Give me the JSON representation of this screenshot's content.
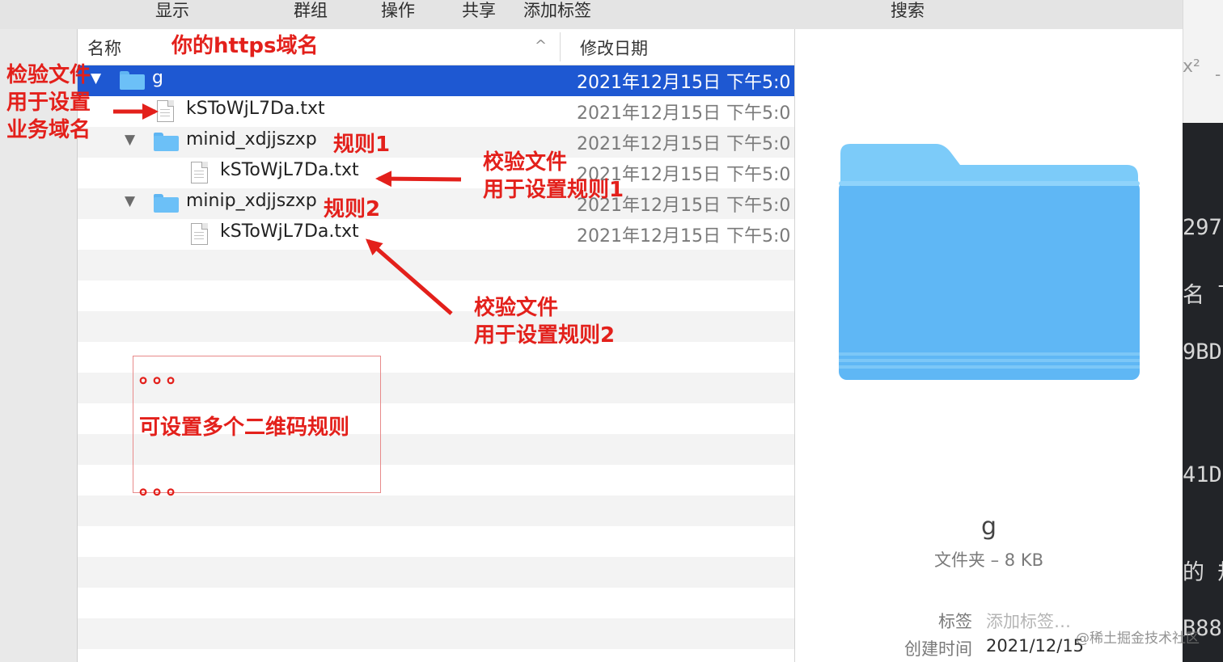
{
  "toolbar": {
    "items": [
      "显示",
      "群组",
      "操作",
      "共享",
      "添加标签"
    ],
    "search_label": "搜索"
  },
  "list": {
    "col_name": "名称",
    "col_date": "修改日期",
    "rows": [
      {
        "name": "g",
        "date": "2021年12月15日 下午5:0",
        "kind": "folder",
        "expanded": true,
        "selected": true
      },
      {
        "name": "kSToWjL7Da.txt",
        "date": "2021年12月15日 下午5:0",
        "kind": "file"
      },
      {
        "name": "minid_xdjjszxp",
        "date": "2021年12月15日 下午5:0",
        "kind": "folder",
        "expanded": true
      },
      {
        "name": "kSToWjL7Da.txt",
        "date": "2021年12月15日 下午5:0",
        "kind": "file"
      },
      {
        "name": "minip_xdjjszxp",
        "date": "2021年12月15日 下午5:0",
        "kind": "folder",
        "expanded": true
      },
      {
        "name": "kSToWjL7Da.txt",
        "date": "2021年12月15日 下午5:0",
        "kind": "file"
      }
    ]
  },
  "preview": {
    "name": "g",
    "kind_size": "文件夹 – 8 KB",
    "tags_label": "标签",
    "tags_placeholder": "添加标签…",
    "created_label": "创建时间",
    "created_value": "2021/12/15"
  },
  "right_strip": {
    "lines": [
      "297",
      "名 下",
      "9BD",
      "41D",
      "的 规",
      "B88"
    ]
  },
  "annotations": {
    "https_domain": "你的https域名",
    "verify_business": [
      "检验文件",
      "用于设置",
      "业务域名"
    ],
    "rule1_tag": "规则1",
    "rule2_tag": "规则2",
    "verify_rule1": [
      "校验文件",
      "用于设置规则1"
    ],
    "verify_rule2": [
      "校验文件",
      "用于设置规则2"
    ],
    "dots_top": "。。。",
    "multi_rules": "可设置多个二维码规则",
    "dots_bottom": "。。。"
  },
  "watermark": "@稀土掘金技术社区",
  "colors": {
    "selection": "#1e58d2",
    "annotation": "#e3201b",
    "folder": "#6cc0f7"
  }
}
